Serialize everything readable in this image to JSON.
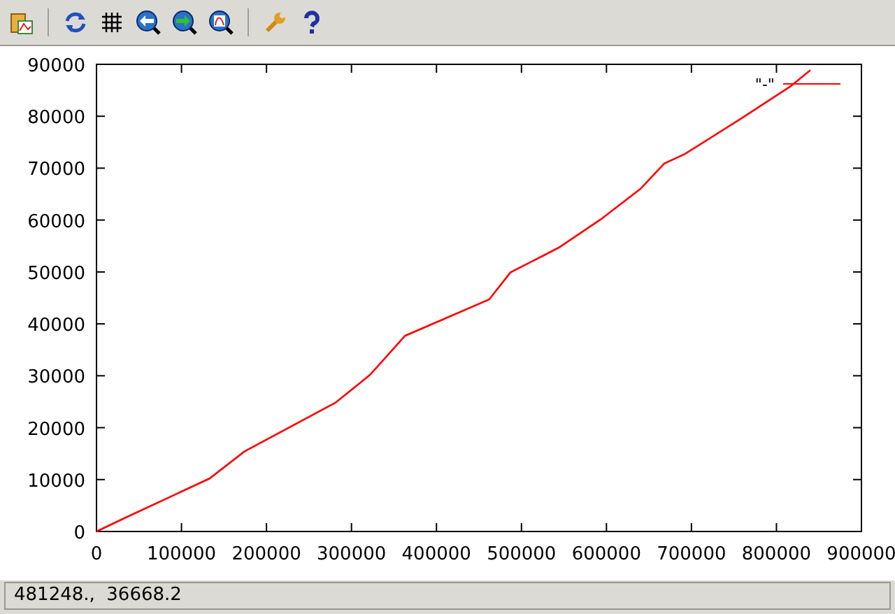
{
  "plot": {
    "chart_data": {
      "type": "line",
      "xlim": [
        0,
        900000
      ],
      "ylim": [
        0,
        90000
      ],
      "xticks": [
        0,
        100000,
        200000,
        300000,
        400000,
        500000,
        600000,
        700000,
        800000,
        900000
      ],
      "yticks": [
        0,
        10000,
        20000,
        30000,
        40000,
        50000,
        60000,
        70000,
        80000,
        90000
      ],
      "x": [
        0,
        34500,
        133000,
        174000,
        281000,
        322000,
        363000,
        462000,
        487000,
        544000,
        593000,
        640000,
        668000,
        692000,
        758000,
        816000,
        840000
      ],
      "series": [
        {
          "name": "\"-\"",
          "color": "#ff0000",
          "values": [
            0,
            2700,
            10200,
            15400,
            24800,
            30200,
            37700,
            44700,
            49900,
            54700,
            60100,
            66000,
            70900,
            72700,
            79500,
            85700,
            88900
          ]
        }
      ]
    }
  },
  "status_bar": {
    "text": "481248.,  36668.2"
  }
}
